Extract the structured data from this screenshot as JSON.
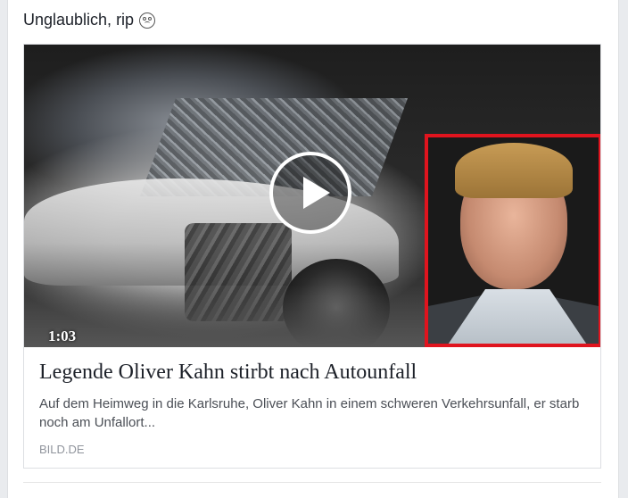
{
  "post": {
    "caption": "Unglaublich, rip",
    "caption_emoji": "weary-face-icon"
  },
  "link_card": {
    "video_duration": "1:03",
    "headline": "Legende Oliver Kahn stirbt nach Autounfall",
    "description": "Auf dem Heimweg in die Karlsruhe, Oliver Kahn in einem schweren Verkehrsunfall, er starb noch am Unfallort...",
    "source": "BILD.DE",
    "inset_border_color": "#e0141e"
  }
}
